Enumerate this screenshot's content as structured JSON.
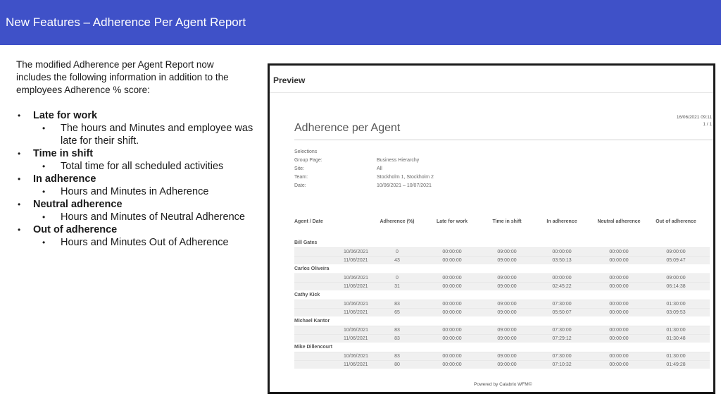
{
  "header": {
    "title": "New Features – Adherence Per Agent Report"
  },
  "intro": "The modified Adherence per Agent Report now includes the following information in addition to the employees Adherence % score:",
  "bullets": [
    {
      "title": "Late for work",
      "sub": [
        "The hours and Minutes and employee was late for their shift."
      ]
    },
    {
      "title": "Time in shift",
      "sub": [
        "Total time for all scheduled activities"
      ]
    },
    {
      "title": "In adherence",
      "sub": [
        "Hours and Minutes in Adherence"
      ]
    },
    {
      "title": "Neutral adherence",
      "sub": [
        "Hours and Minutes of Neutral Adherence"
      ]
    },
    {
      "title": "Out of adherence",
      "sub": [
        "Hours and Minutes Out of Adherence"
      ]
    }
  ],
  "preview": {
    "title": "Preview",
    "stamp_date": "16/06/2021 09:11",
    "stamp_page": "1 / 1",
    "report_title": "Adherence per Agent",
    "selections": [
      {
        "label": "Selections",
        "value": ""
      },
      {
        "label": "Group Page:",
        "value": "Business Hierarchy"
      },
      {
        "label": "Site:",
        "value": "All"
      },
      {
        "label": "Team:",
        "value": "Stockholm 1, Stockholm 2"
      },
      {
        "label": "Date:",
        "value": "10/06/2021 – 10/07/2021"
      }
    ],
    "columns": [
      "Agent / Date",
      "Adherence (%)",
      "Late for work",
      "Time in shift",
      "In adherence",
      "Neutral adherence",
      "Out of adherence"
    ],
    "agents": [
      {
        "name": "Bill Gates",
        "rows": [
          [
            "10/06/2021",
            "0",
            "00:00:00",
            "09:00:00",
            "00:00:00",
            "00:00:00",
            "09:00:00"
          ],
          [
            "11/06/2021",
            "43",
            "00:00:00",
            "09:00:00",
            "03:50:13",
            "00:00:00",
            "05:09:47"
          ]
        ]
      },
      {
        "name": "Carlos Oliveira",
        "rows": [
          [
            "10/06/2021",
            "0",
            "00:00:00",
            "09:00:00",
            "00:00:00",
            "00:00:00",
            "09:00:00"
          ],
          [
            "11/06/2021",
            "31",
            "00:00:00",
            "09:00:00",
            "02:45:22",
            "00:00:00",
            "06:14:38"
          ]
        ]
      },
      {
        "name": "Cathy Kick",
        "rows": [
          [
            "10/06/2021",
            "83",
            "00:00:00",
            "09:00:00",
            "07:30:00",
            "00:00:00",
            "01:30:00"
          ],
          [
            "11/06/2021",
            "65",
            "00:00:00",
            "09:00:00",
            "05:50:07",
            "00:00:00",
            "03:09:53"
          ]
        ]
      },
      {
        "name": "Michael Kantor",
        "rows": [
          [
            "10/06/2021",
            "83",
            "00:00:00",
            "09:00:00",
            "07:30:00",
            "00:00:00",
            "01:30:00"
          ],
          [
            "11/06/2021",
            "83",
            "00:00:00",
            "09:00:00",
            "07:29:12",
            "00:00:00",
            "01:30:48"
          ]
        ]
      },
      {
        "name": "Mike Dillencourt",
        "rows": [
          [
            "10/06/2021",
            "83",
            "00:00:00",
            "09:00:00",
            "07:30:00",
            "00:00:00",
            "01:30:00"
          ],
          [
            "11/06/2021",
            "80",
            "00:00:00",
            "09:00:00",
            "07:10:32",
            "00:00:00",
            "01:49:28"
          ]
        ]
      }
    ],
    "footer": "Powered by Calabrio WFM©"
  }
}
